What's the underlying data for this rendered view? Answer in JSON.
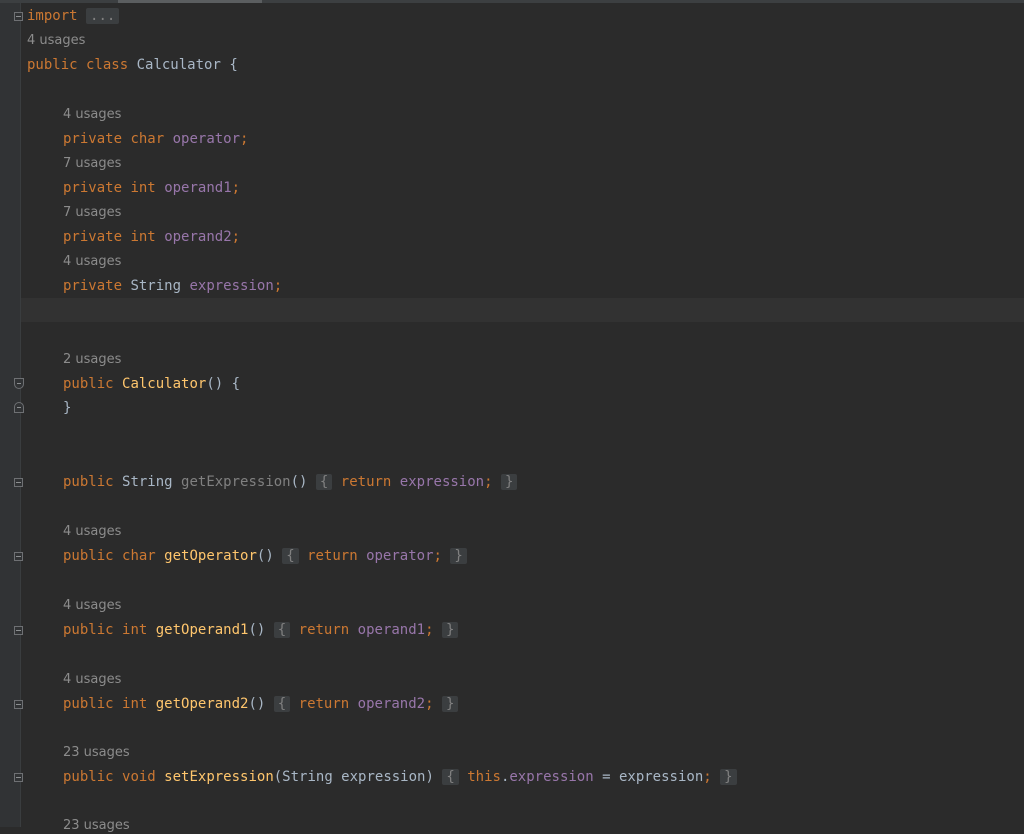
{
  "editor": {
    "import_keyword": "import",
    "import_fold": "...",
    "class_usages": "4 usages",
    "class_decl": {
      "mods": "public class",
      "name": "Calculator",
      "brace": " {"
    },
    "fields": [
      {
        "usages": "4 usages",
        "mod": "private",
        "type": "char",
        "name": "operator"
      },
      {
        "usages": "7 usages",
        "mod": "private",
        "type": "int",
        "name": "operand1"
      },
      {
        "usages": "7 usages",
        "mod": "private",
        "type": "int",
        "name": "operand2"
      },
      {
        "usages": "4 usages",
        "mod": "private",
        "type": "String",
        "name": "expression"
      }
    ],
    "constructor": {
      "usages": "2 usages",
      "mod": "public",
      "name": "Calculator",
      "params": "() {",
      "close": "}"
    },
    "methods": [
      {
        "usages": "",
        "mod": "public",
        "type": "String",
        "name": "getExpression",
        "params": "()",
        "body_kw": "return",
        "body_expr": "expression",
        "semi": ";"
      },
      {
        "usages": "4 usages",
        "mod": "public",
        "type": "char",
        "name": "getOperator",
        "params": "()",
        "body_kw": "return",
        "body_expr": "operator",
        "semi": ";"
      },
      {
        "usages": "4 usages",
        "mod": "public",
        "type": "int",
        "name": "getOperand1",
        "params": "()",
        "body_kw": "return",
        "body_expr": "operand1",
        "semi": ";"
      },
      {
        "usages": "4 usages",
        "mod": "public",
        "type": "int",
        "name": "getOperand2",
        "params": "()",
        "body_kw": "return",
        "body_expr": "operand2",
        "semi": ";"
      }
    ],
    "setter": {
      "usages": "23 usages",
      "mod": "public",
      "type": "void",
      "name": "setExpression",
      "param_open": "(String expression)",
      "this_kw": "this",
      "dot": ".",
      "field": "expression",
      "assign": " = expression",
      "semi": ";"
    },
    "trailing_usages": "23 usages",
    "fold_open": "{",
    "fold_close": "}"
  },
  "colors": {
    "background": "#2b2b2b",
    "keyword": "#cc7832",
    "field": "#9876aa",
    "method": "#ffc66d",
    "text": "#a9b7c6",
    "hint": "#8c8c8c"
  }
}
